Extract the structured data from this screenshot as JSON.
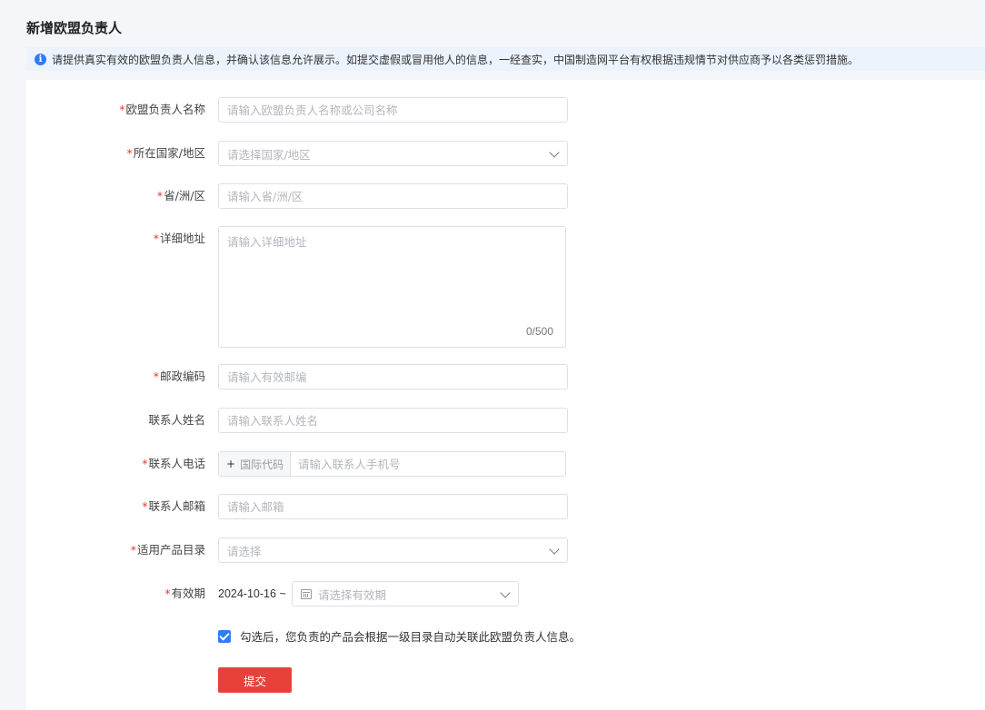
{
  "page": {
    "title": "新增欧盟负责人",
    "notice": "请提供真实有效的欧盟负责人信息，并确认该信息允许展示。如提交虚假或冒用他人的信息，一经查实，中国制造网平台有权根据违规情节对供应商予以各类惩罚措施。"
  },
  "form": {
    "name": {
      "label": "欧盟负责人名称",
      "placeholder": "请输入欧盟负责人名称或公司名称",
      "value": ""
    },
    "country": {
      "label": "所在国家/地区",
      "placeholder": "请选择国家/地区"
    },
    "province": {
      "label": "省/洲/区",
      "placeholder": "请输入省/洲/区",
      "value": ""
    },
    "address": {
      "label": "详细地址",
      "placeholder": "请输入详细地址",
      "value": "",
      "counter": "0/500"
    },
    "postcode": {
      "label": "邮政编码",
      "placeholder": "请输入有效邮编",
      "value": ""
    },
    "contact_name": {
      "label": "联系人姓名",
      "placeholder": "请输入联系人姓名",
      "value": ""
    },
    "phone": {
      "label": "联系人电话",
      "prefix_plus": "+",
      "prefix_placeholder": "国际代码",
      "placeholder": "请输入联系人手机号",
      "value": ""
    },
    "email": {
      "label": "联系人邮箱",
      "placeholder": "请输入邮箱",
      "value": ""
    },
    "catalog": {
      "label": "适用产品目录",
      "placeholder": "请选择"
    },
    "validity": {
      "label": "有效期",
      "start": "2024-10-16",
      "separator": "~",
      "placeholder": "请选择有效期"
    },
    "auto_link": {
      "checked": true,
      "label": "勾选后，您负责的产品会根据一级目录自动关联此欧盟负责人信息。"
    },
    "submit_label": "提交"
  },
  "colors": {
    "accent": "#2f7cf6",
    "required": "#e53935",
    "submit": "#e8413c",
    "notice_bg": "#ecf3fd"
  }
}
